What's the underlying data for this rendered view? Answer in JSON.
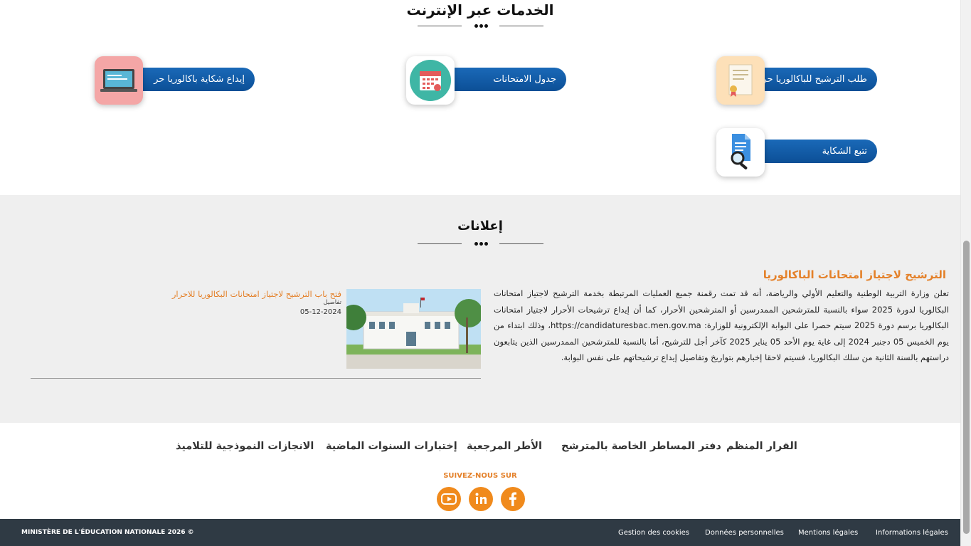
{
  "services": {
    "title": "الخدمات عبر الإنترنت",
    "items": [
      {
        "label": "إيداع شكاية باكالوريا حر",
        "icon": "laptop-icon"
      },
      {
        "label": "جدول الامتحانات",
        "icon": "calendar-icon"
      },
      {
        "label": "طلب الترشيح للباكالوريا حر",
        "icon": "certificate-icon"
      },
      {
        "label": "تتبع الشكاية",
        "icon": "document-search-icon"
      }
    ]
  },
  "announcements": {
    "title": "إعلانات",
    "main_title": "الترشيح لاجتياز امتحانات الباكالوريا",
    "main_text": "تعلن وزارة التربية الوطنية والتعليم الأولي والرياضة، أنه قد تمت رقمنة جميع العمليات المرتبطة بخدمة الترشيح لاجتياز امتحانات البكالوريا لدورة 2025 سواء بالنسبة للمترشحين الممدرسين أو المترشحين الأحرار، كما أن إيداع ترشيحات الأحرار لاجتياز امتحانات البكالوريا برسم دورة 2025 سيتم حصرا على البوابة الإلكترونية للوزارة: https://candidaturesbac.men.gov.ma، وذلك ابتداء من يوم الخميس 05 دجنبر 2024 إلى غاية يوم الأحد 05 يناير 2025 كآخر أجل للترشيح، أما بالنسبة للمترشحين الممدرسين الذين يتابعون دراستهم بالسنة الثانية من سلك البكالوريا، فسيتم لاحقا إخبارهم بتواريخ وتفاصيل إيداع ترشيحاتهم على نفس البوابة.",
    "news": {
      "title": "فتح باب الترشيح لاجتياز امتحانات البكالوريا للاحرار",
      "details": "تفاصيل",
      "date": "05-12-2024"
    }
  },
  "footer": {
    "links": [
      "القرار المنظم",
      "دفتر المساطر الخاصة بالمترشح",
      "الأطر المرجعية",
      "إختبارات السنوات الماضية",
      "الانجازات النموذجية للتلاميذ"
    ],
    "follow_label": "SUIVEZ-NOUS SUR",
    "social": [
      "facebook-icon",
      "linkedin-icon",
      "youtube-icon"
    ]
  },
  "bottom_bar": {
    "copyright": "MINISTÈRE DE L'ÉDUCATION NATIONALE 2026 ©",
    "links": [
      "Informations légales",
      "Mentions légales",
      "Données personnelles",
      "Gestion des cookies"
    ]
  },
  "colors": {
    "accent_orange": "#e4812a",
    "pill_blue": "#0c4f96",
    "footer_dark": "#2f3a44"
  }
}
